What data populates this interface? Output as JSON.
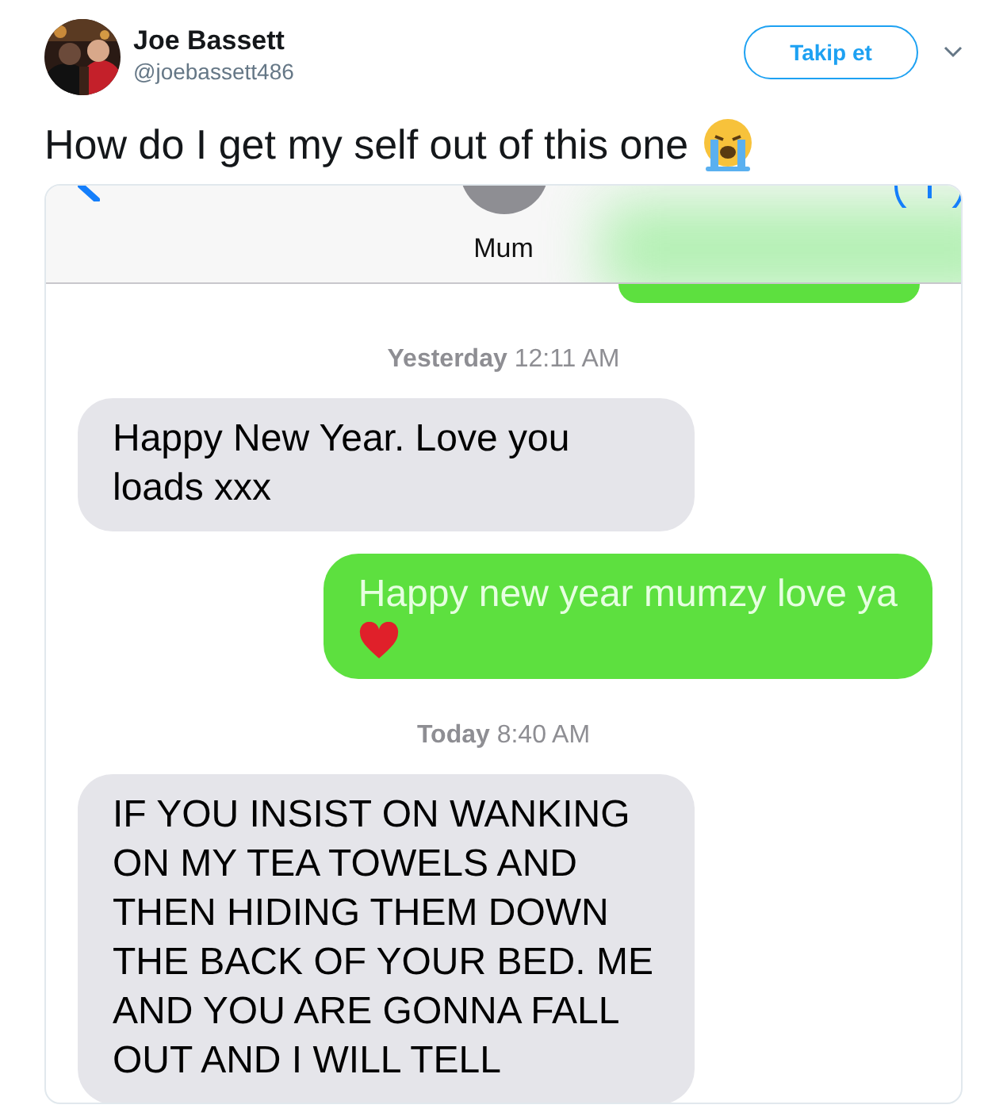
{
  "author": {
    "name": "Joe Bassett",
    "handle": "@joebassett486"
  },
  "follow_button": "Takip et",
  "tweet": {
    "text": "How do I get my self out of this one",
    "trailing_emoji": true
  },
  "conversation": {
    "contact": "Mum",
    "messages": [
      {
        "kind": "partial"
      },
      {
        "kind": "timestamp",
        "text": "**Yesterday** 12:11 AM"
      },
      {
        "kind": "received",
        "text": "Happy New Year. Love you loads xxx",
        "trailing_emoji": false
      },
      {
        "kind": "sent",
        "text": "Happy new year mumzy love ya",
        "trailing_emoji": true
      },
      {
        "kind": "timestamp",
        "text": "**Today** 8:40 AM"
      },
      {
        "kind": "received",
        "text": "IF YOU INSIST ON WANKING ON MY TEA TOWELS AND THEN HIDING THEM DOWN THE BACK OF YOUR BED. ME AND YOU ARE GONNA FALL OUT AND I WILL TELL",
        "trailing_emoji": false
      }
    ]
  }
}
